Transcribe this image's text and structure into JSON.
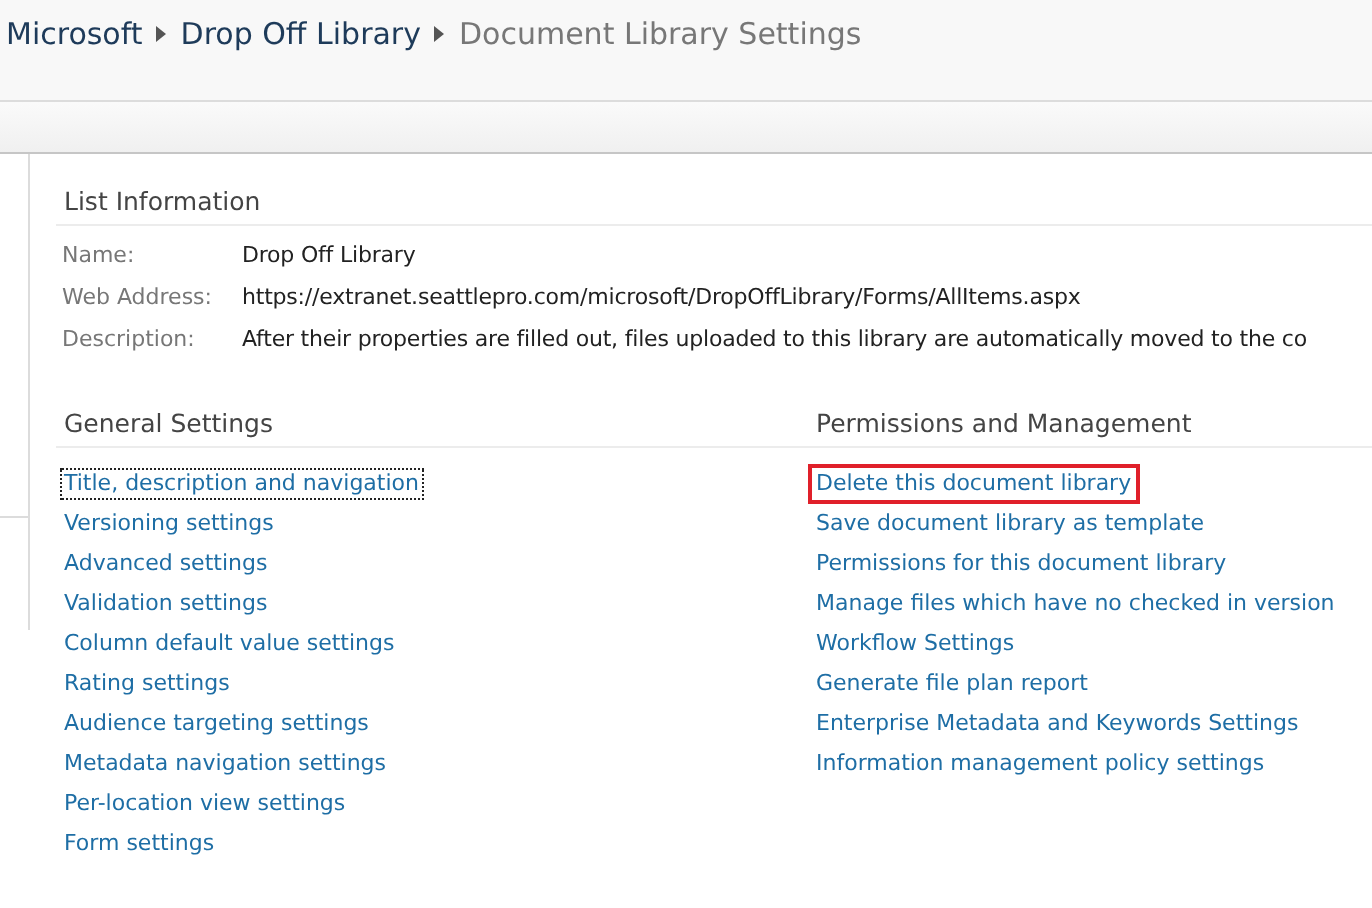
{
  "breadcrumb": [
    {
      "label": "Microsoft",
      "current": false
    },
    {
      "label": "Drop Off Library",
      "current": false
    },
    {
      "label": "Document Library Settings",
      "current": true
    }
  ],
  "list_information": {
    "title": "List Information",
    "fields": [
      {
        "label": "Name:",
        "value": "Drop Off Library"
      },
      {
        "label": "Web Address:",
        "value": "https://extranet.seattlepro.com/microsoft/DropOffLibrary/Forms/AllItems.aspx"
      },
      {
        "label": "Description:",
        "value": "After their properties are filled out, files uploaded to this library are automatically moved to the co"
      }
    ]
  },
  "sections": [
    {
      "title": "General Settings",
      "links": [
        {
          "label": "Title, description and navigation",
          "focused": true,
          "highlighted": false
        },
        {
          "label": "Versioning settings",
          "focused": false,
          "highlighted": false
        },
        {
          "label": "Advanced settings",
          "focused": false,
          "highlighted": false
        },
        {
          "label": "Validation settings",
          "focused": false,
          "highlighted": false
        },
        {
          "label": "Column default value settings",
          "focused": false,
          "highlighted": false
        },
        {
          "label": "Rating settings",
          "focused": false,
          "highlighted": false
        },
        {
          "label": "Audience targeting settings",
          "focused": false,
          "highlighted": false
        },
        {
          "label": "Metadata navigation settings",
          "focused": false,
          "highlighted": false
        },
        {
          "label": "Per-location view settings",
          "focused": false,
          "highlighted": false
        },
        {
          "label": "Form settings",
          "focused": false,
          "highlighted": false
        }
      ]
    },
    {
      "title": "Permissions and Management",
      "links": [
        {
          "label": "Delete this document library",
          "focused": false,
          "highlighted": true
        },
        {
          "label": "Save document library as template",
          "focused": false,
          "highlighted": false
        },
        {
          "label": "Permissions for this document library",
          "focused": false,
          "highlighted": false
        },
        {
          "label": "Manage files which have no checked in version",
          "focused": false,
          "highlighted": false
        },
        {
          "label": "Workflow Settings",
          "focused": false,
          "highlighted": false
        },
        {
          "label": "Generate file plan report",
          "focused": false,
          "highlighted": false
        },
        {
          "label": "Enterprise Metadata and Keywords Settings",
          "focused": false,
          "highlighted": false
        },
        {
          "label": "Information management policy settings",
          "focused": false,
          "highlighted": false
        }
      ]
    }
  ]
}
